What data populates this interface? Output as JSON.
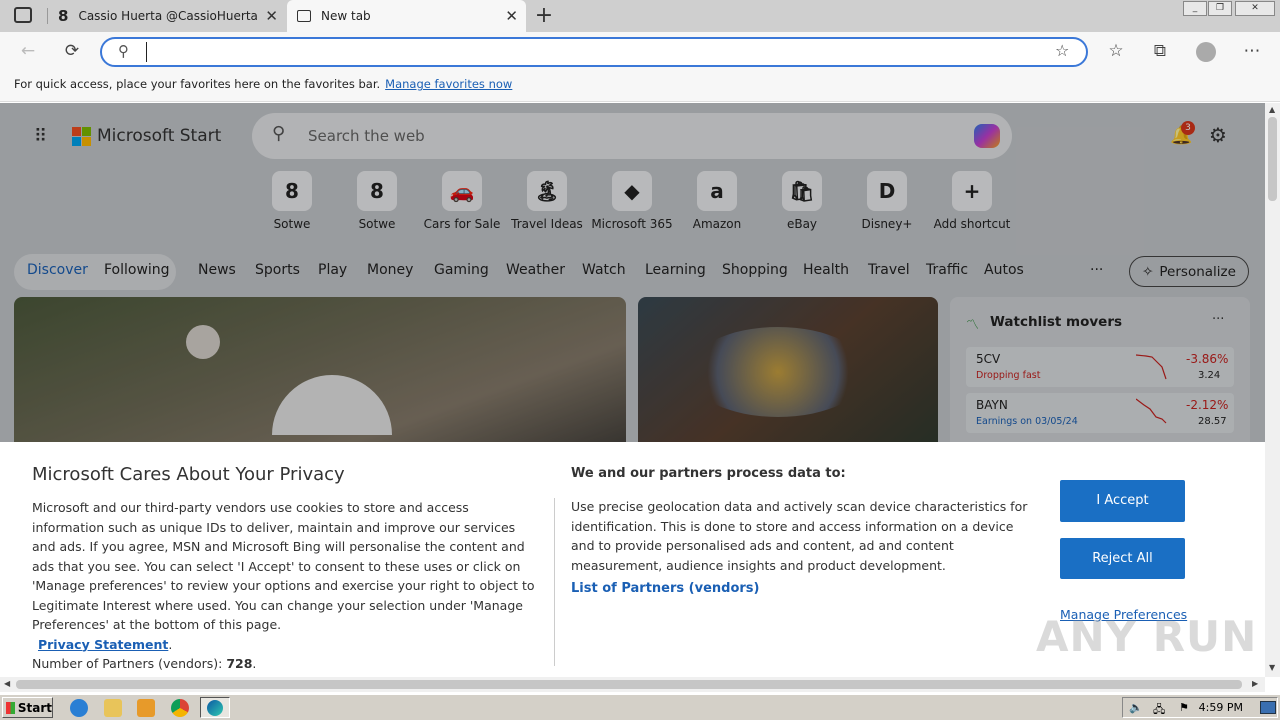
{
  "tabs": [
    {
      "title": "Cassio Huerta @CassioHuerta - T"
    },
    {
      "title": "New tab"
    }
  ],
  "new_tab_symbol": "+",
  "address_bar": {
    "value": "",
    "placeholder": ""
  },
  "favorites_hint": {
    "text": "For quick access, place your favorites here on the favorites bar.",
    "link": "Manage favorites now"
  },
  "msn": {
    "brand": "Microsoft Start",
    "search_placeholder": "Search the web",
    "notification_count": "3",
    "shortcuts": [
      {
        "label": "Sotwe",
        "glyph": "8"
      },
      {
        "label": "Sotwe",
        "glyph": "8"
      },
      {
        "label": "Cars for Sale",
        "glyph": "🚗"
      },
      {
        "label": "Travel Ideas",
        "glyph": "🏝"
      },
      {
        "label": "Microsoft 365",
        "glyph": "◆"
      },
      {
        "label": "Amazon",
        "glyph": "a"
      },
      {
        "label": "eBay",
        "glyph": "🛍"
      },
      {
        "label": "Disney+",
        "glyph": "D"
      },
      {
        "label": "Add shortcut",
        "glyph": "+"
      }
    ],
    "feed_tabs": [
      "Discover",
      "Following"
    ],
    "nav": [
      "News",
      "Sports",
      "Play",
      "Money",
      "Gaming",
      "Weather",
      "Watch",
      "Learning",
      "Shopping",
      "Health",
      "Travel",
      "Traffic",
      "Autos"
    ],
    "more": "···",
    "personalize": "Personalize",
    "watchlist": {
      "title": "Watchlist movers",
      "more": "···",
      "items": [
        {
          "symbol": "5CV",
          "sub": "Dropping fast",
          "change": "-3.86%",
          "price": "3.24"
        },
        {
          "symbol": "BAYN",
          "sub": "Earnings on 03/05/24",
          "change": "-2.12%",
          "price": "28.57"
        }
      ]
    }
  },
  "privacy": {
    "title": "Microsoft Cares About Your Privacy",
    "body": "Microsoft and our third-party vendors use cookies to store and access information such as unique IDs to deliver, maintain and improve our services and ads. If you agree, MSN and Microsoft Bing will personalise the content and ads that you see. You can select 'I Accept' to consent to these uses or click on 'Manage preferences' to review your options and exercise your right to object to Legitimate Interest where used.  You can change your selection under 'Manage Preferences' at the bottom of this page.",
    "privacy_link": "Privacy Statement",
    "partners_label": "Number of Partners (vendors): ",
    "partners_count": "728",
    "purpose_title": "We and our partners process data to:",
    "purpose_body": "Use precise geolocation data and actively scan device characteristics for identification. This is done to store and access information on a device and to provide personalised ads and content, ad and content measurement, audience insights and product development.",
    "partners_link": "List of Partners (vendors)",
    "accept": "I Accept",
    "reject": "Reject All",
    "manage": "Manage Preferences"
  },
  "watermark": "ANY RUN",
  "taskbar": {
    "start": "Start",
    "clock": "4:59 PM"
  },
  "colors": {
    "accent": "#1a6fc4",
    "address_border": "#3b78d8",
    "negative": "#c5221f"
  }
}
